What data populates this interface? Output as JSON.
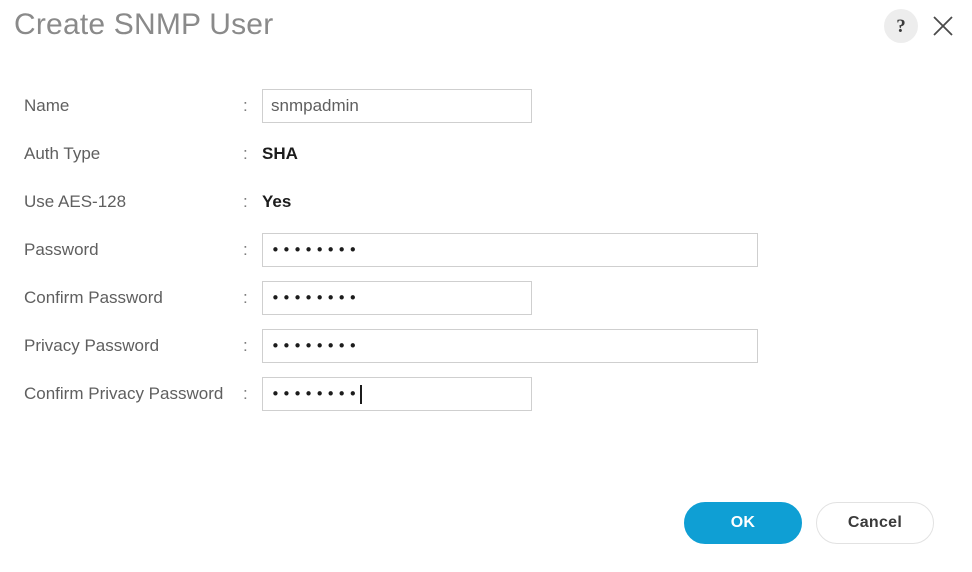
{
  "dialog": {
    "title": "Create SNMP User",
    "help_icon": "question-mark-icon",
    "close_icon": "close-icon",
    "colon": ":"
  },
  "form": {
    "rows": [
      {
        "label": "Name",
        "type": "text",
        "value": "snmpadmin",
        "width": "narrow"
      },
      {
        "label": "Auth Type",
        "type": "static",
        "value": "SHA"
      },
      {
        "label": "Use AES-128",
        "type": "static",
        "value": "Yes"
      },
      {
        "label": "Password",
        "type": "password",
        "mask": "••••••••",
        "width": "wide",
        "focused": false
      },
      {
        "label": "Confirm Password",
        "type": "password",
        "mask": "••••••••",
        "width": "narrow",
        "focused": false
      },
      {
        "label": "Privacy Password",
        "type": "password",
        "mask": "••••••••",
        "width": "wide",
        "focused": false
      },
      {
        "label": "Confirm Privacy Password",
        "type": "password",
        "mask": "••••••••",
        "width": "narrow",
        "focused": true
      }
    ]
  },
  "footer": {
    "ok_label": "OK",
    "cancel_label": "Cancel"
  },
  "colors": {
    "accent": "#0f9fd4",
    "label": "#5f9f9f",
    "title": "#8a8a8a"
  }
}
